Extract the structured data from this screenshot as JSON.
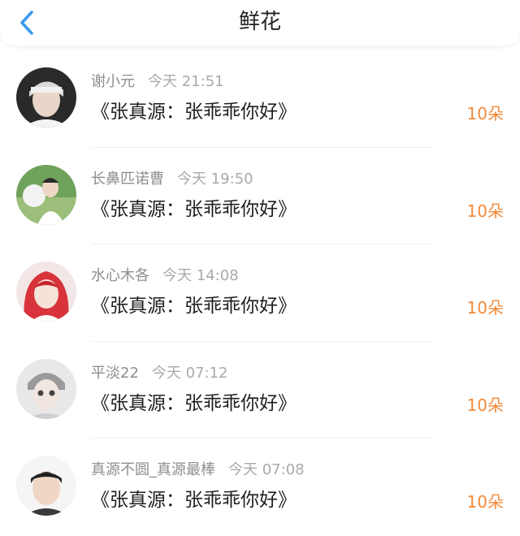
{
  "header": {
    "title": "鲜花",
    "back_icon": "chevron-left-icon",
    "accent_color": "#3a9bf0"
  },
  "items": [
    {
      "user": "谢小元",
      "time": "今天 21:51",
      "gift": "《张真源：张乖乖你好》",
      "count": "10朵"
    },
    {
      "user": "长鼻匹诺曹",
      "time": "今天 19:50",
      "gift": "《张真源：张乖乖你好》",
      "count": "10朵"
    },
    {
      "user": "水心木各",
      "time": "今天 14:08",
      "gift": "《张真源：张乖乖你好》",
      "count": "10朵"
    },
    {
      "user": "平淡22",
      "time": "今天 07:12",
      "gift": "《张真源：张乖乖你好》",
      "count": "10朵"
    },
    {
      "user": "真源不圆_真源最棒",
      "time": "今天 07:08",
      "gift": "《张真源：张乖乖你好》",
      "count": "10朵"
    }
  ],
  "count_color": "#f28a3a"
}
